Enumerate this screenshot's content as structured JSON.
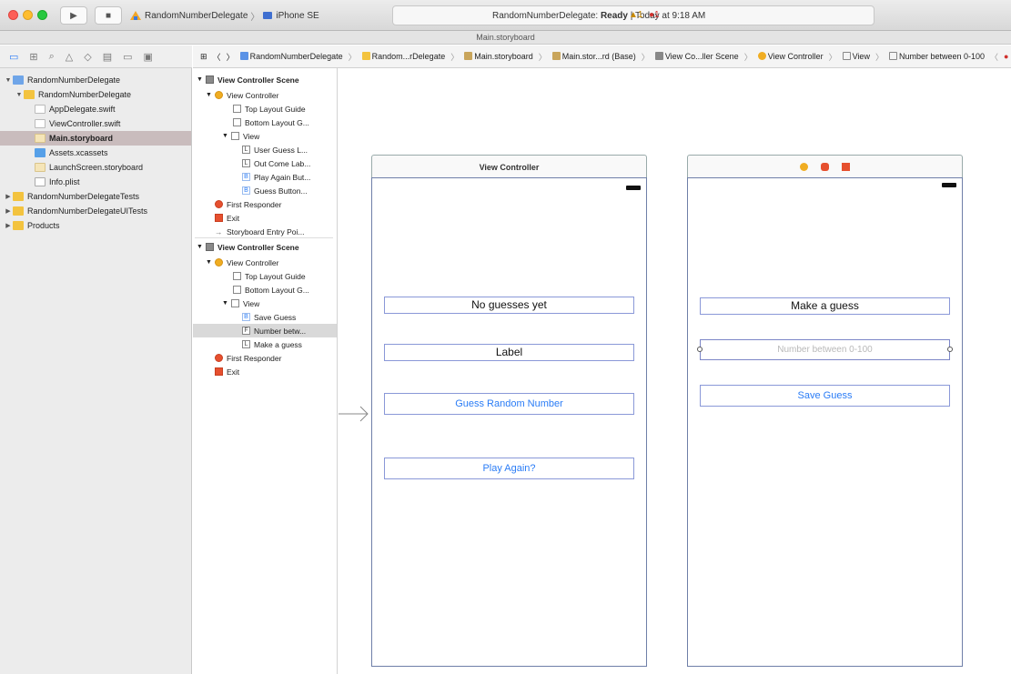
{
  "toolbar": {
    "run_icon": "▶",
    "stop_icon": "■",
    "scheme_name": "RandomNumberDelegate",
    "scheme_separator": "〉",
    "device_name": "iPhone SE",
    "status_project": "RandomNumberDelegate:",
    "status_state": "Ready",
    "status_time": "| Today at 9:18 AM",
    "warning_count": "▲1",
    "error_count": "●1"
  },
  "window_title": "Main.storyboard",
  "navigator": {
    "items": [
      {
        "label": "RandomNumberDelegate",
        "indent": 0,
        "icon": "project",
        "disc": "▼"
      },
      {
        "label": "RandomNumberDelegate",
        "indent": 1,
        "icon": "folder",
        "disc": "▼"
      },
      {
        "label": "AppDelegate.swift",
        "indent": 2,
        "icon": "swift",
        "disc": ""
      },
      {
        "label": "ViewController.swift",
        "indent": 2,
        "icon": "swift",
        "disc": ""
      },
      {
        "label": "Main.storyboard",
        "indent": 2,
        "icon": "storyboard",
        "disc": ""
      },
      {
        "label": "Assets.xcassets",
        "indent": 2,
        "icon": "assets",
        "disc": ""
      },
      {
        "label": "LaunchScreen.storyboard",
        "indent": 2,
        "icon": "storyboard",
        "disc": ""
      },
      {
        "label": "Info.plist",
        "indent": 2,
        "icon": "plist",
        "disc": ""
      },
      {
        "label": "RandomNumberDelegateTests",
        "indent": 0,
        "icon": "folder",
        "disc": "▶"
      },
      {
        "label": "RandomNumberDelegateUITests",
        "indent": 0,
        "icon": "folder",
        "disc": "▶"
      },
      {
        "label": "Products",
        "indent": 0,
        "icon": "folder",
        "disc": "▶"
      }
    ],
    "selected_index": 4
  },
  "jumpbar": {
    "items": [
      "RandomNumberDelegate",
      "Random...rDelegate",
      "Main.storyboard",
      "Main.stor...rd (Base)",
      "View Co...ller Scene",
      "View Controller",
      "View",
      "Number between 0-100"
    ]
  },
  "outline": {
    "scene1": {
      "title": "View Controller Scene",
      "vc": "View Controller",
      "top_guide": "Top Layout Guide",
      "bottom_guide": "Bottom Layout G...",
      "view": "View",
      "items": [
        "User Guess L...",
        "Out Come Lab...",
        "Play Again But...",
        "Guess Button..."
      ],
      "item_icons": [
        "L",
        "L",
        "B",
        "B"
      ],
      "first_responder": "First Responder",
      "exit": "Exit",
      "entry_point": "Storyboard Entry Poi..."
    },
    "scene2": {
      "title": "View Controller Scene",
      "vc": "View Controller",
      "top_guide": "Top Layout Guide",
      "bottom_guide": "Bottom Layout G...",
      "view": "View",
      "items": [
        "Save Guess",
        "Number betw...",
        "Make a guess"
      ],
      "item_icons": [
        "B",
        "F",
        "L"
      ],
      "first_responder": "First Responder",
      "exit": "Exit"
    }
  },
  "canvas": {
    "vc1": {
      "title": "View Controller",
      "no_guesses_label": "No guesses yet",
      "label": "Label",
      "guess_button": "Guess Random Number",
      "play_again_button": "Play Again?"
    },
    "vc2": {
      "make_guess_label": "Make a guess",
      "number_field_placeholder": "Number between 0-100",
      "save_button": "Save Guess"
    }
  },
  "colors": {
    "accent": "#2a7cf6",
    "selection": "#c9bcbd",
    "vc_icon": "#f0ad22",
    "exit_icon": "#e6502f"
  }
}
